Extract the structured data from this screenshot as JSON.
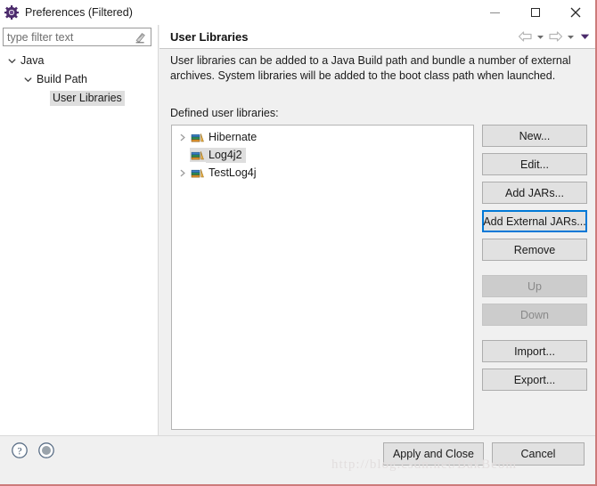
{
  "window": {
    "title": "Preferences (Filtered)",
    "title_icon": "preferences-gear-icon",
    "minimize_label": "Minimize",
    "maximize_label": "Maximize",
    "close_label": "Close",
    "border_color": "#cd7b7b"
  },
  "sidebar": {
    "filter": {
      "placeholder": "type filter text",
      "value": "",
      "clear_icon": "clear-filter-eraser-icon"
    },
    "tree": [
      {
        "label": "Java",
        "level": 0,
        "expanded": true,
        "has_arrow": true,
        "selected": false
      },
      {
        "label": "Build Path",
        "level": 1,
        "expanded": true,
        "has_arrow": true,
        "selected": false
      },
      {
        "label": "User Libraries",
        "level": 2,
        "expanded": false,
        "has_arrow": false,
        "selected": true
      }
    ]
  },
  "content": {
    "page_title": "User Libraries",
    "nav": {
      "back_icon": "arrow-left-icon",
      "back_dropdown_icon": "chevron-down-icon",
      "forward_icon": "arrow-right-icon",
      "forward_dropdown_icon": "chevron-down-icon",
      "menu_icon": "chevron-down-filled-icon"
    },
    "description": "User libraries can be added to a Java Build path and bundle a number of external archives. System libraries will be added to the boot class path when launched.",
    "defined_label": "Defined user libraries:",
    "libraries": [
      {
        "name": "Hibernate",
        "has_arrow": true,
        "selected": false,
        "icon": "library-books-icon"
      },
      {
        "name": "Log4j2",
        "has_arrow": false,
        "selected": true,
        "icon": "library-books-icon"
      },
      {
        "name": "TestLog4j",
        "has_arrow": true,
        "selected": false,
        "icon": "library-books-icon"
      }
    ],
    "side_buttons": [
      {
        "label": "New...",
        "state": "enabled"
      },
      {
        "label": "Edit...",
        "state": "enabled"
      },
      {
        "label": "Add JARs...",
        "state": "enabled"
      },
      {
        "label": "Add External JARs...",
        "state": "focused"
      },
      {
        "label": "Remove",
        "state": "enabled"
      },
      {
        "label": "Up",
        "state": "disabled"
      },
      {
        "label": "Down",
        "state": "disabled"
      },
      {
        "label": "Import...",
        "state": "enabled"
      },
      {
        "label": "Export...",
        "state": "enabled"
      }
    ]
  },
  "bottom": {
    "help_icon": "help-question-icon",
    "secondary_icon": "circle-dot-icon",
    "apply_label": "Apply and Close",
    "cancel_label": "Cancel"
  },
  "watermark": {
    "text": "http://blog.csdn.net/BakBeom"
  },
  "colors": {
    "accent": "#0078d7",
    "selection": "#dedede",
    "panel_bg": "#f0f0f0",
    "button_bg": "#e1e1e1"
  }
}
